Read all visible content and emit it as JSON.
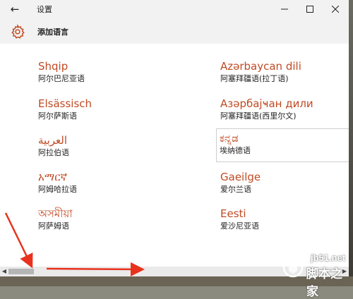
{
  "window": {
    "title": "设置",
    "back_icon": "←",
    "controls": {
      "minimize": "minimize-icon",
      "maximize": "maximize-icon",
      "close": "close-icon"
    }
  },
  "header": {
    "icon": "gear-icon",
    "title": "添加语言"
  },
  "languages": {
    "left": [
      {
        "native": "Shqip",
        "chinese": "阿尔巴尼亚语"
      },
      {
        "native": "Elsässisch",
        "chinese": "阿尔萨斯语"
      },
      {
        "native": "العربية",
        "chinese": "阿拉伯语"
      },
      {
        "native": "አማርኛ",
        "chinese": "阿姆哈拉语"
      },
      {
        "native": "অসমীয়া",
        "chinese": "阿萨姆语"
      }
    ],
    "right": [
      {
        "native": "Azərbaycan dili",
        "chinese": "阿塞拜疆语(拉丁语)"
      },
      {
        "native": "Азәрбајҹан дили",
        "chinese": "阿塞拜疆语(西里尔文)"
      },
      {
        "native": "ಕನ್ನಡ",
        "chinese": "埃纳德语"
      },
      {
        "native": "Gaeilge",
        "chinese": "爱尔兰语"
      },
      {
        "native": "Eesti",
        "chinese": "爱沙尼亚语"
      }
    ],
    "accent_color": "#c04a23"
  },
  "scrollbar": {
    "left_arrow": "◀",
    "right_arrow": "▶"
  },
  "watermark": {
    "site": "jb51.net",
    "name": "脚本之家"
  },
  "annotation_color": "#e8321e"
}
